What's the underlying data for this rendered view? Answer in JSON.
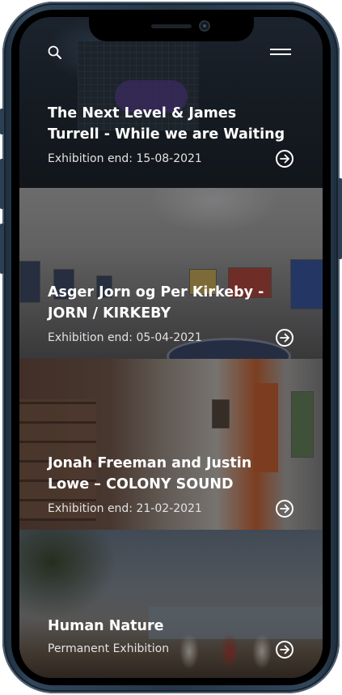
{
  "header": {
    "search_icon": "search-icon",
    "menu_icon": "hamburger-menu-icon"
  },
  "exhibitions": [
    {
      "title": "The Next Level & James Turrell - While we are Waiting",
      "subtitle": "Exhibition end: 15-08-2021"
    },
    {
      "title": "Asger Jorn og Per Kirkeby - JORN / KIRKEBY",
      "subtitle": "Exhibition end: 05-04-2021"
    },
    {
      "title": "Jonah Freeman and Justin Lowe – COLONY SOUND",
      "subtitle": "Exhibition end: 21-02-2021"
    },
    {
      "title": "Human Nature",
      "subtitle": "Permanent Exhibition"
    }
  ],
  "colors": {
    "text": "#ffffff",
    "subtitle": "#e2e2e2",
    "device_frame": "#253646"
  },
  "icons": {
    "card_arrow": "arrow-right-circle-icon"
  }
}
